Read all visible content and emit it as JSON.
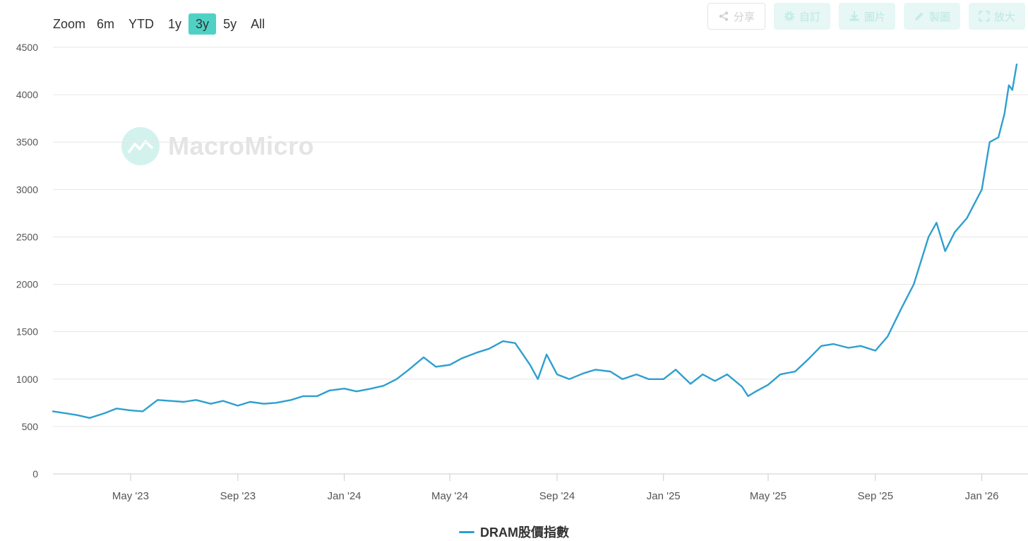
{
  "zoom": {
    "label": "Zoom",
    "options": [
      "6m",
      "YTD",
      "1y",
      "3y",
      "5y",
      "All"
    ],
    "selected": "3y"
  },
  "toolbar": {
    "share_label": "分享",
    "custom_label": "自訂",
    "image_label": "圖片",
    "draw_label": "製圖",
    "expand_label": "放大"
  },
  "watermark": {
    "text": "MacroMicro"
  },
  "colors": {
    "series": "#2e9fcf",
    "grid": "#e6e6e6",
    "accent": "#4fd1c5"
  },
  "chart_data": {
    "type": "line",
    "title": "",
    "xlabel": "",
    "ylabel": "",
    "ylim": [
      0,
      4500
    ],
    "xlim": [
      "2023-02-01",
      "2026-02-10"
    ],
    "yticks": [
      0,
      500,
      1000,
      1500,
      2000,
      2500,
      3000,
      3500,
      4000,
      4500
    ],
    "xticks": [
      {
        "date": "2023-05-01",
        "label": "May '23"
      },
      {
        "date": "2023-09-01",
        "label": "Sep '23"
      },
      {
        "date": "2024-01-01",
        "label": "Jan '24"
      },
      {
        "date": "2024-05-01",
        "label": "May '24"
      },
      {
        "date": "2024-09-01",
        "label": "Sep '24"
      },
      {
        "date": "2025-01-01",
        "label": "Jan '25"
      },
      {
        "date": "2025-05-01",
        "label": "May '25"
      },
      {
        "date": "2025-09-01",
        "label": "Sep '25"
      },
      {
        "date": "2026-01-01",
        "label": "Jan '26"
      }
    ],
    "grid": true,
    "legend_position": "bottom-center",
    "series": [
      {
        "name": "DRAM股價指數",
        "color": "#2e9fcf",
        "x": [
          "2023-02-01",
          "2023-02-15",
          "2023-03-01",
          "2023-03-15",
          "2023-04-01",
          "2023-04-15",
          "2023-05-01",
          "2023-05-15",
          "2023-06-01",
          "2023-06-15",
          "2023-07-01",
          "2023-07-15",
          "2023-08-01",
          "2023-08-15",
          "2023-09-01",
          "2023-09-15",
          "2023-10-01",
          "2023-10-15",
          "2023-11-01",
          "2023-11-15",
          "2023-12-01",
          "2023-12-15",
          "2024-01-01",
          "2024-01-15",
          "2024-02-01",
          "2024-02-15",
          "2024-03-01",
          "2024-03-15",
          "2024-04-01",
          "2024-04-15",
          "2024-05-01",
          "2024-05-15",
          "2024-06-01",
          "2024-06-15",
          "2024-07-01",
          "2024-07-15",
          "2024-08-01",
          "2024-08-10",
          "2024-08-20",
          "2024-09-01",
          "2024-09-15",
          "2024-10-01",
          "2024-10-15",
          "2024-11-01",
          "2024-11-15",
          "2024-12-01",
          "2024-12-15",
          "2025-01-01",
          "2025-01-15",
          "2025-02-01",
          "2025-02-15",
          "2025-03-01",
          "2025-03-15",
          "2025-04-01",
          "2025-04-08",
          "2025-04-15",
          "2025-05-01",
          "2025-05-15",
          "2025-06-01",
          "2025-06-15",
          "2025-07-01",
          "2025-07-15",
          "2025-08-01",
          "2025-08-15",
          "2025-09-01",
          "2025-09-15",
          "2025-10-01",
          "2025-10-15",
          "2025-11-01",
          "2025-11-10",
          "2025-11-20",
          "2025-12-01",
          "2025-12-15",
          "2026-01-01",
          "2026-01-10",
          "2026-01-20",
          "2026-01-27",
          "2026-02-01",
          "2026-02-05",
          "2026-02-10"
        ],
        "values": [
          660,
          640,
          620,
          590,
          640,
          690,
          670,
          660,
          780,
          770,
          760,
          780,
          740,
          770,
          720,
          760,
          740,
          750,
          780,
          820,
          820,
          880,
          900,
          870,
          900,
          930,
          1000,
          1100,
          1230,
          1130,
          1150,
          1220,
          1280,
          1320,
          1400,
          1380,
          1150,
          1000,
          1260,
          1050,
          1000,
          1060,
          1100,
          1080,
          1000,
          1050,
          1000,
          1000,
          1100,
          950,
          1050,
          980,
          1050,
          920,
          820,
          860,
          940,
          1050,
          1080,
          1200,
          1350,
          1370,
          1330,
          1350,
          1300,
          1450,
          1750,
          2000,
          2500,
          2650,
          2350,
          2550,
          2700,
          3000,
          3500,
          3550,
          3800,
          4100,
          4050,
          4320
        ]
      }
    ]
  }
}
